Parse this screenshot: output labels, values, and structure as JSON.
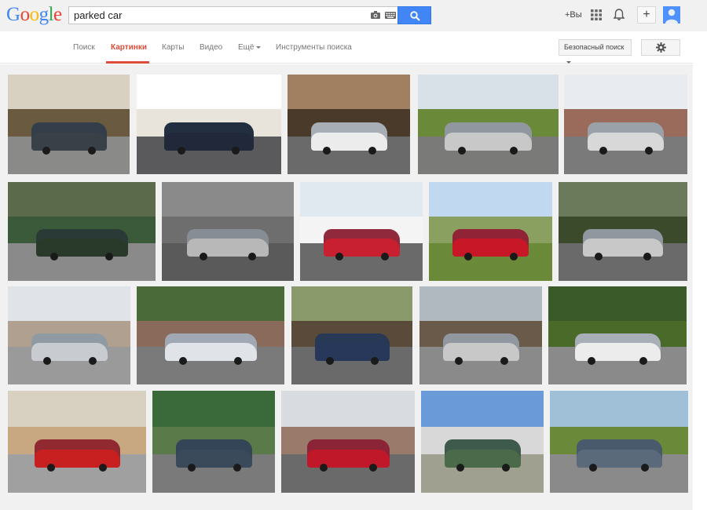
{
  "logo": {
    "letters": [
      "G",
      "o",
      "o",
      "g",
      "l",
      "e"
    ],
    "colors": [
      "#4285f4",
      "#ea4335",
      "#fbbc05",
      "#4285f4",
      "#34a853",
      "#ea4335"
    ]
  },
  "search": {
    "query": "parked car"
  },
  "header": {
    "plus_you": "+Вы"
  },
  "nav": {
    "items": [
      "Поиск",
      "Картинки",
      "Карты",
      "Видео",
      "Ещё",
      "Инструменты поиска"
    ],
    "active": "Картинки"
  },
  "toolbar": {
    "safe_search": "Безопасный поиск"
  },
  "colors": {
    "accent_blue": "#4285f4",
    "active_red": "#dd4b39",
    "background": "#f1f1f1"
  },
  "images": [
    {
      "sky": "#d8d0c0",
      "ground": "#8a8a88",
      "car": "#3a4048",
      "wall": "#6a5a40"
    },
    {
      "sky": "#ffffff",
      "ground": "#5a5a5c",
      "car": "#20283a",
      "wall": "#e8e4dc"
    },
    {
      "sky": "#a08060",
      "ground": "#6a6a6a",
      "car": "#ececec",
      "wall": "#4a3a2a"
    },
    {
      "sky": "#d8e0e8",
      "ground": "#7a7a78",
      "car": "#c8c8c8",
      "wall": "#6a8a3a"
    },
    {
      "sky": "#e8ecf0",
      "ground": "#7a7a7a",
      "car": "#d8d8d8",
      "wall": "#9a6a5a"
    },
    {
      "sky": "#5a6a4a",
      "ground": "#8a8a8a",
      "car": "#2a3a2a",
      "wall": "#3a5a3a"
    },
    {
      "sky": "#8a8a8a",
      "ground": "#5a5a5a",
      "car": "#b8b8b8",
      "wall": "#6e6e6e"
    },
    {
      "sky": "#e0e8f0",
      "ground": "#6a6a6a",
      "car": "#c82030",
      "wall": "#f4f4f4"
    },
    {
      "sky": "#c0d8f0",
      "ground": "#6a8a3a",
      "car": "#c81828",
      "wall": "#8aa060"
    },
    {
      "sky": "#6a7a5a",
      "ground": "#6a6a6a",
      "car": "#c8c8c8",
      "wall": "#3a4a2a"
    },
    {
      "sky": "#e0e4e8",
      "ground": "#9a9a9a",
      "car": "#c8ccd0",
      "wall": "#b0a090"
    },
    {
      "sky": "#4a6a3a",
      "ground": "#7a7a7a",
      "car": "#e0e4e8",
      "wall": "#8a6a5a"
    },
    {
      "sky": "#8a9a6a",
      "ground": "#6a6a6a",
      "car": "#28385a",
      "wall": "#5a4a3a"
    },
    {
      "sky": "#b0b8c0",
      "ground": "#8a8a8a",
      "car": "#c8c8c8",
      "wall": "#6a5a4a"
    },
    {
      "sky": "#3a5a2a",
      "ground": "#8a8a8a",
      "car": "#ececec",
      "wall": "#4a6a2a"
    },
    {
      "sky": "#d8d0c0",
      "ground": "#a0a0a0",
      "car": "#c82020",
      "wall": "#c8a880"
    },
    {
      "sky": "#3a6a3a",
      "ground": "#7a7a7a",
      "car": "#3a4a5a",
      "wall": "#5a7a4a"
    },
    {
      "sky": "#d8dce0",
      "ground": "#6a6a6a",
      "car": "#c01828",
      "wall": "#9a7a6a"
    },
    {
      "sky": "#6a9ad8",
      "ground": "#a0a090",
      "car": "#4a6a4a",
      "wall": "#d8d8d8"
    },
    {
      "sky": "#a0c0d8",
      "ground": "#8a8a8a",
      "car": "#5a6a7a",
      "wall": "#6a8a3a"
    }
  ]
}
